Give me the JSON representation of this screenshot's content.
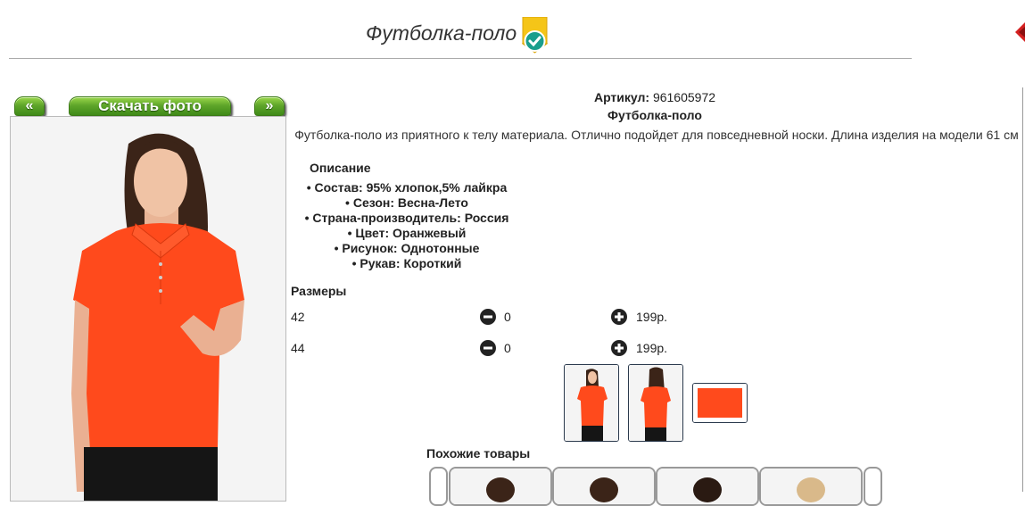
{
  "header": {
    "title": "Футболка-поло"
  },
  "icons": {
    "badge": "verified-badge-icon",
    "close": "close-icon",
    "minus": "minus-circle-icon",
    "plus": "plus-circle-icon"
  },
  "gallery": {
    "prev_label": "«",
    "download_label": "Скачать фото",
    "next_label": "»"
  },
  "product": {
    "article_label": "Артикул:",
    "article_value": "961605972",
    "name": "Футболка-поло",
    "description": "Футболка-поло из приятного к телу материала. Отлично подойдет для повседневной носки. Длина изделия на модели 61 см",
    "details_heading": "Описание",
    "features": [
      "Состав: 95% хлопок,5% лайкра",
      "Сезон: Весна-Лето",
      "Страна-производитель: Россия",
      "Цвет: Оранжевый",
      "Рисунок: Однотонные",
      "Рукав: Короткий"
    ]
  },
  "sizes": {
    "heading": "Размеры",
    "rows": [
      {
        "size": "42",
        "qty": "0",
        "price": "199р."
      },
      {
        "size": "44",
        "qty": "0",
        "price": "199р."
      }
    ]
  },
  "similar": {
    "heading": "Похожие товары"
  },
  "colors": {
    "shirt": "#ff4a1c",
    "button_green": "#5fa62a",
    "badge_yellow": "#f5c518",
    "badge_teal": "#1a9e8c",
    "close_red": "#d42020"
  }
}
